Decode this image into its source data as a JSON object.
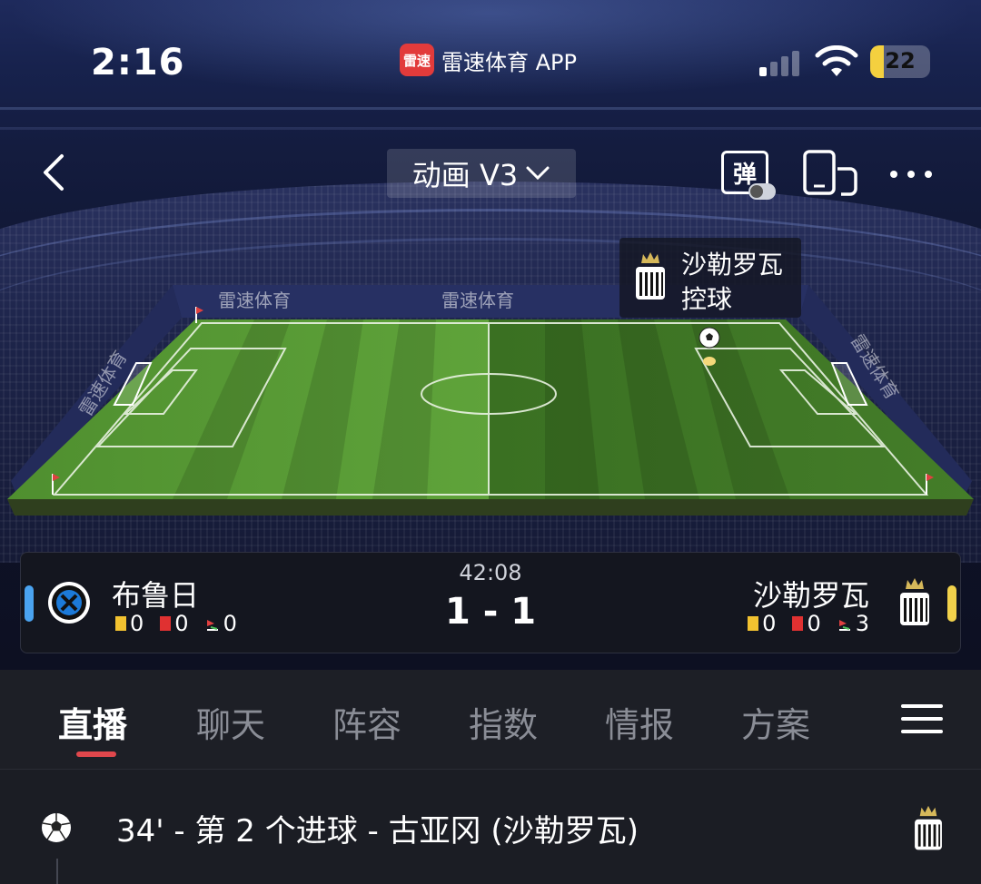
{
  "status_bar": {
    "time": "2:16",
    "app_badge": "雷速",
    "app_name": "雷速体育 APP",
    "battery": "22",
    "battery_level_pct": 22
  },
  "nav": {
    "mode_label": "动画 V3",
    "danmu_label": "弹"
  },
  "field": {
    "watermark": "雷速体育",
    "possession_team": "沙勒罗瓦",
    "possession_state": "控球"
  },
  "match": {
    "time": "42:08",
    "score": "1 - 1",
    "home": {
      "name": "布鲁日",
      "yellow": "0",
      "red": "0",
      "corners": "0"
    },
    "away": {
      "name": "沙勒罗瓦",
      "yellow": "0",
      "red": "0",
      "corners": "3"
    }
  },
  "tabs": [
    {
      "label": "直播"
    },
    {
      "label": "聊天"
    },
    {
      "label": "阵容"
    },
    {
      "label": "指数"
    },
    {
      "label": "情报"
    },
    {
      "label": "方案"
    }
  ],
  "events": [
    {
      "text": "34' - 第 2 个进球 - 古亚冈 (沙勒罗瓦)"
    }
  ],
  "colors": {
    "accent": "#e0474c",
    "home_marker": "#4aa3f0",
    "away_marker": "#f2d24b",
    "pitch_light": "#5fa33a",
    "pitch_dark": "#3f7a26"
  },
  "icons": {
    "back": "chevron-left-icon",
    "mode_toggle": "chevron-down-icon",
    "danmu": "danmu-icon",
    "screen": "screen-rotate-icon",
    "more": "ellipsis-icon",
    "menu": "hamburger-icon",
    "event": "soccer-ball-icon"
  }
}
